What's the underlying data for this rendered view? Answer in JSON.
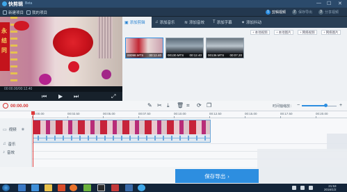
{
  "window": {
    "app_name": "快剪辑",
    "beta": "Beta",
    "controls": [
      "—",
      "☐",
      "✕"
    ]
  },
  "toolbar": {
    "new_project": "新建项目",
    "my_projects": "我的项目"
  },
  "steps": [
    {
      "num": "1",
      "label": "剪辑视频"
    },
    {
      "num": "2",
      "label": "保存导出"
    },
    {
      "num": "3",
      "label": "分享视频"
    }
  ],
  "preview": {
    "couplet_text": "永结同",
    "time": "00:00.00/00:12.40"
  },
  "tabs": [
    {
      "label": "添加剪辑"
    },
    {
      "label": "添加音乐"
    },
    {
      "label": "添加音效"
    },
    {
      "label": "添加字幕"
    },
    {
      "label": "添加抖动"
    }
  ],
  "sub_buttons": [
    "本地视频",
    "本地图片",
    "网络视频",
    "网络图片"
  ],
  "clips": [
    {
      "name": "00098.MTS",
      "duration": "00:12.40"
    },
    {
      "name": "00130.MTS",
      "duration": "00:12.40"
    },
    {
      "name": "00136.MTS",
      "duration": "00:07.20"
    }
  ],
  "editor": {
    "playhead_time": "00:00.00",
    "zoom_label": "时间轴缩放：",
    "zoom_level": 0.68
  },
  "ruler_ticks": [
    "00:00.00",
    "00:02.50",
    "00:05.00",
    "00:07.50",
    "00:10.00",
    "00:12.50",
    "00:15.00",
    "00:17.50",
    "00:20.00"
  ],
  "tracks": [
    {
      "label": "视频"
    },
    {
      "label": "音乐"
    },
    {
      "label": "音效"
    }
  ],
  "export": {
    "label": "保存导出"
  },
  "taskbar": {
    "time": "21:53",
    "date": "2016/1/2"
  },
  "colors": {
    "accent": "#2d8ee0",
    "playhead": "#e03a3a"
  }
}
